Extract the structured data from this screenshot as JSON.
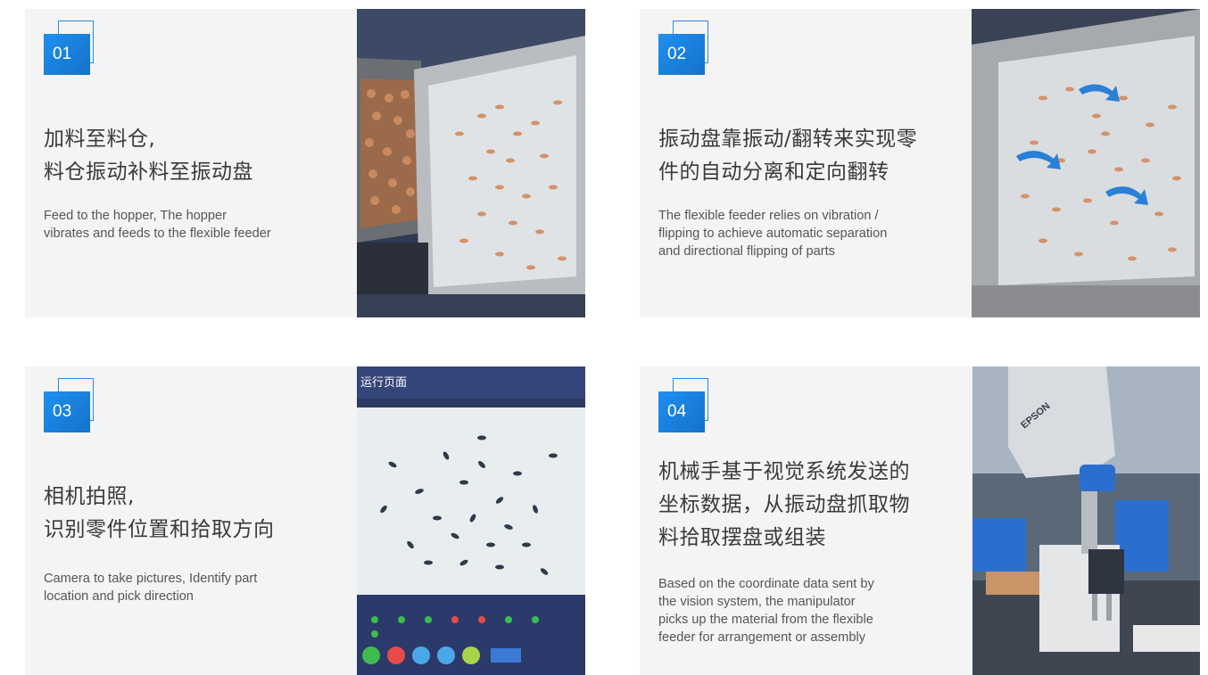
{
  "cards": [
    {
      "number": "01",
      "title_cn": [
        "加料至料仓,",
        "料仓振动补料至振动盘"
      ],
      "desc_en": [
        "Feed to the hopper, The hopper",
        "vibrates and feeds to the flexible feeder"
      ],
      "photo_icon": "hopper-feeder-photo"
    },
    {
      "number": "02",
      "title_cn": [
        "振动盘靠振动/翻转来实现零",
        "件的自动分离和定向翻转"
      ],
      "desc_en": [
        "The flexible feeder relies on vibration /",
        "flipping to achieve automatic separation",
        "and directional flipping of parts"
      ],
      "photo_icon": "flexible-feeder-photo"
    },
    {
      "number": "03",
      "title_cn": [
        "相机拍照,",
        "识别零件位置和拾取方向"
      ],
      "desc_en": [
        "Camera to take pictures, Identify part",
        "location and pick direction"
      ],
      "photo_icon": "vision-screen-photo",
      "screen_title": "运行页面"
    },
    {
      "number": "04",
      "title_cn": [
        "机械手基于视觉系统发送的",
        "坐标数据，从振动盘抓取物",
        "料拾取摆盘或组装"
      ],
      "desc_en": [
        "Based on the coordinate data sent by",
        "the vision system, the manipulator",
        "picks up the material from the flexible",
        "feeder for arrangement or assembly"
      ],
      "photo_icon": "robot-arm-photo",
      "robot_brand": "EPSON"
    }
  ],
  "colors": {
    "accent": "#1f8ff0",
    "card_bg": "#f4f4f4",
    "text": "#3a3a3a"
  }
}
